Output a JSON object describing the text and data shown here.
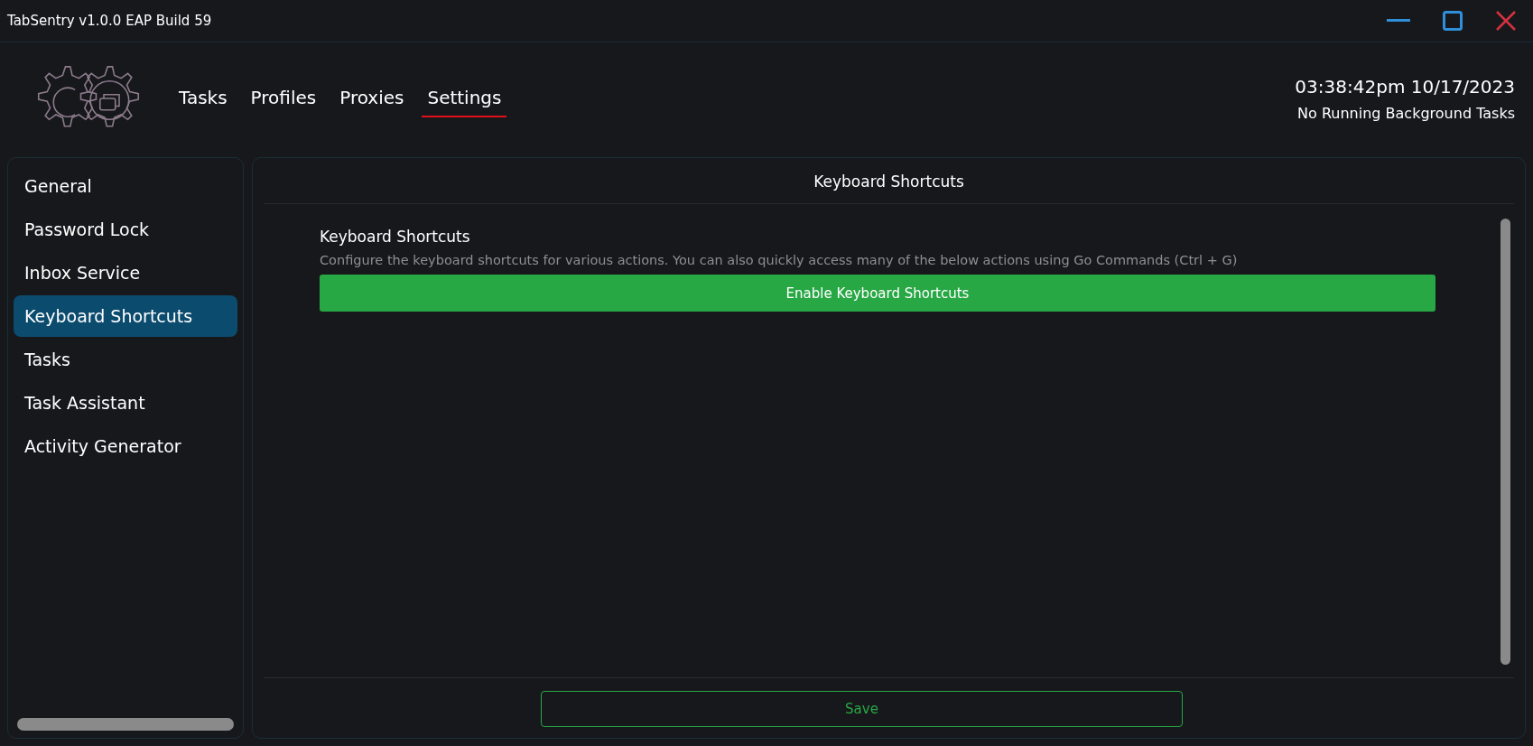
{
  "window": {
    "title": "TabSentry v1.0.0 EAP Build 59"
  },
  "nav": [
    {
      "label": "Tasks",
      "selected": false
    },
    {
      "label": "Profiles",
      "selected": false
    },
    {
      "label": "Proxies",
      "selected": false
    },
    {
      "label": "Settings",
      "selected": true
    }
  ],
  "clock": "03:38:42pm 10/17/2023",
  "status": "No Running Background Tasks",
  "sidebar": {
    "items": [
      {
        "label": "General",
        "selected": false
      },
      {
        "label": "Password Lock",
        "selected": false
      },
      {
        "label": "Inbox Service",
        "selected": false
      },
      {
        "label": "Keyboard Shortcuts",
        "selected": true
      },
      {
        "label": "Tasks",
        "selected": false
      },
      {
        "label": "Task Assistant",
        "selected": false
      },
      {
        "label": "Activity Generator",
        "selected": false
      }
    ]
  },
  "panel": {
    "title": "Keyboard Shortcuts",
    "section_title": "Keyboard Shortcuts",
    "description": "Configure the keyboard shortcuts for various actions. You can also quickly access many of the below actions using Go Commands (Ctrl + G)",
    "toggle_button": "Enable Keyboard Shortcuts",
    "save_button": "Save"
  }
}
